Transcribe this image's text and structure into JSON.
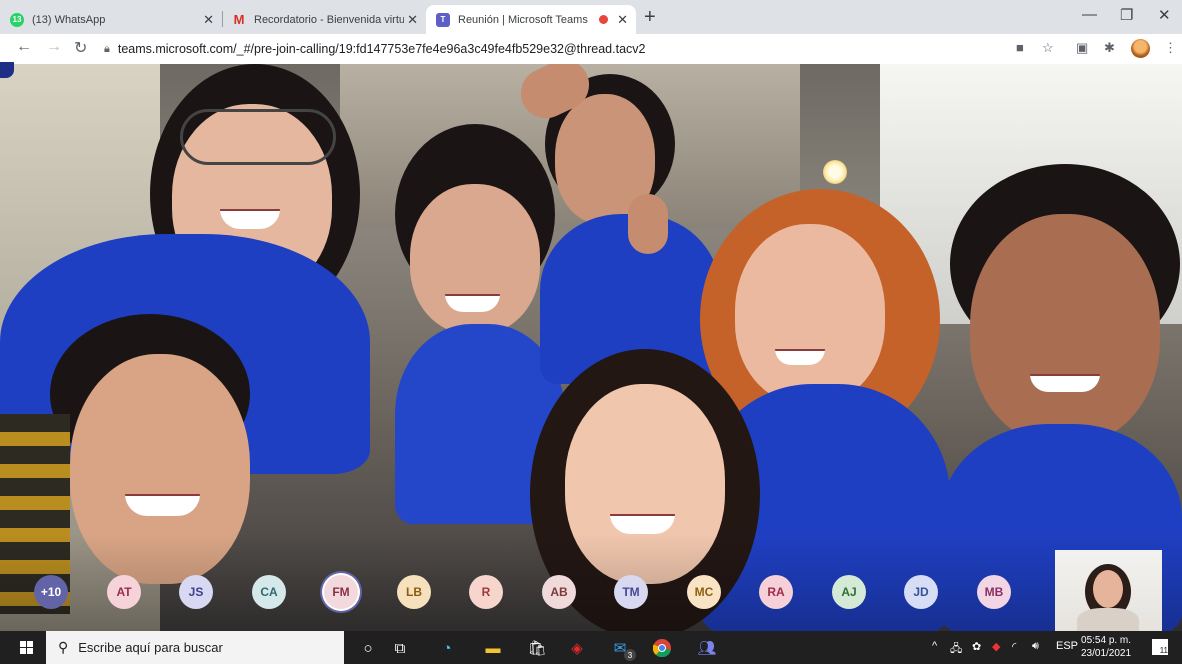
{
  "browser": {
    "tabs": [
      {
        "title": "(13) WhatsApp",
        "icon": "whatsapp-icon",
        "badge": "13"
      },
      {
        "title": "Recordatorio - Bienvenida virtual",
        "icon": "gmail-icon"
      },
      {
        "title": "Reunión | Microsoft Teams",
        "icon": "teams-icon"
      }
    ],
    "url": "teams.microsoft.com/_#/pre-join-calling/19:fd147753e7fe4e96a3c49fe4fb529e32@thread.tacv2"
  },
  "meeting": {
    "participants": [
      {
        "initials": "+10",
        "bg": "#6264a7",
        "fg": "#ffffff"
      },
      {
        "initials": "AT",
        "bg": "#f6d3d9",
        "fg": "#9a2d48"
      },
      {
        "initials": "JS",
        "bg": "#d8d8f3",
        "fg": "#3f3f8c"
      },
      {
        "initials": "CA",
        "bg": "#d5e8ea",
        "fg": "#2f6b72"
      },
      {
        "initials": "FM",
        "bg": "#f1d9dd",
        "fg": "#8a3045"
      },
      {
        "initials": "LB",
        "bg": "#f7e0bc",
        "fg": "#8c5a14"
      },
      {
        "initials": "R",
        "bg": "#f6d6cc",
        "fg": "#a4373a"
      },
      {
        "initials": "AB",
        "bg": "#efd9da",
        "fg": "#7d3a3a"
      },
      {
        "initials": "TM",
        "bg": "#d8d8f0",
        "fg": "#484893"
      },
      {
        "initials": "MC",
        "bg": "#f8e4c4",
        "fg": "#8f5f12"
      },
      {
        "initials": "RA",
        "bg": "#f5d0d8",
        "fg": "#a32b4a"
      },
      {
        "initials": "AJ",
        "bg": "#d5ead6",
        "fg": "#2e6e37"
      },
      {
        "initials": "JD",
        "bg": "#d6ddf4",
        "fg": "#35509a"
      },
      {
        "initials": "MB",
        "bg": "#f3d6e6",
        "fg": "#8a2f63"
      }
    ]
  },
  "taskbar": {
    "search_placeholder": "Escribe aquí para buscar",
    "language": "ESP",
    "time": "05:54 p. m.",
    "date": "23/01/2021",
    "notification_count": "11",
    "mail_badge": "3"
  }
}
